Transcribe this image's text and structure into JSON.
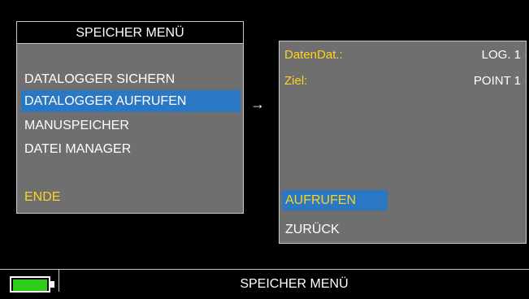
{
  "menu": {
    "title": "SPEICHER MENÜ",
    "items": [
      {
        "label": "DATALOGGER SICHERN"
      },
      {
        "label": "DATALOGGER AUFRUFEN"
      },
      {
        "label": "MANUSPEICHER"
      },
      {
        "label": "DATEI MANAGER"
      }
    ],
    "end_label": "ENDE",
    "selected_index": 1
  },
  "arrow_icon": "right-arrow-icon",
  "detail": {
    "fields": [
      {
        "label": "DatenDat.:",
        "value": "LOG. 1"
      },
      {
        "label": "Ziel:",
        "value": "POINT 1"
      }
    ],
    "buttons": [
      {
        "label": "AUFRUFEN"
      },
      {
        "label": "ZURÜCK"
      }
    ]
  },
  "status_bar": {
    "title": "SPEICHER MENÜ",
    "battery_icon": "battery-icon",
    "battery_level": 1.0
  },
  "colors": {
    "panel": "#6f6f6f",
    "highlight": "#2a77c4",
    "accent_yellow": "#ffd21e",
    "battery_green": "#2ecc18"
  }
}
